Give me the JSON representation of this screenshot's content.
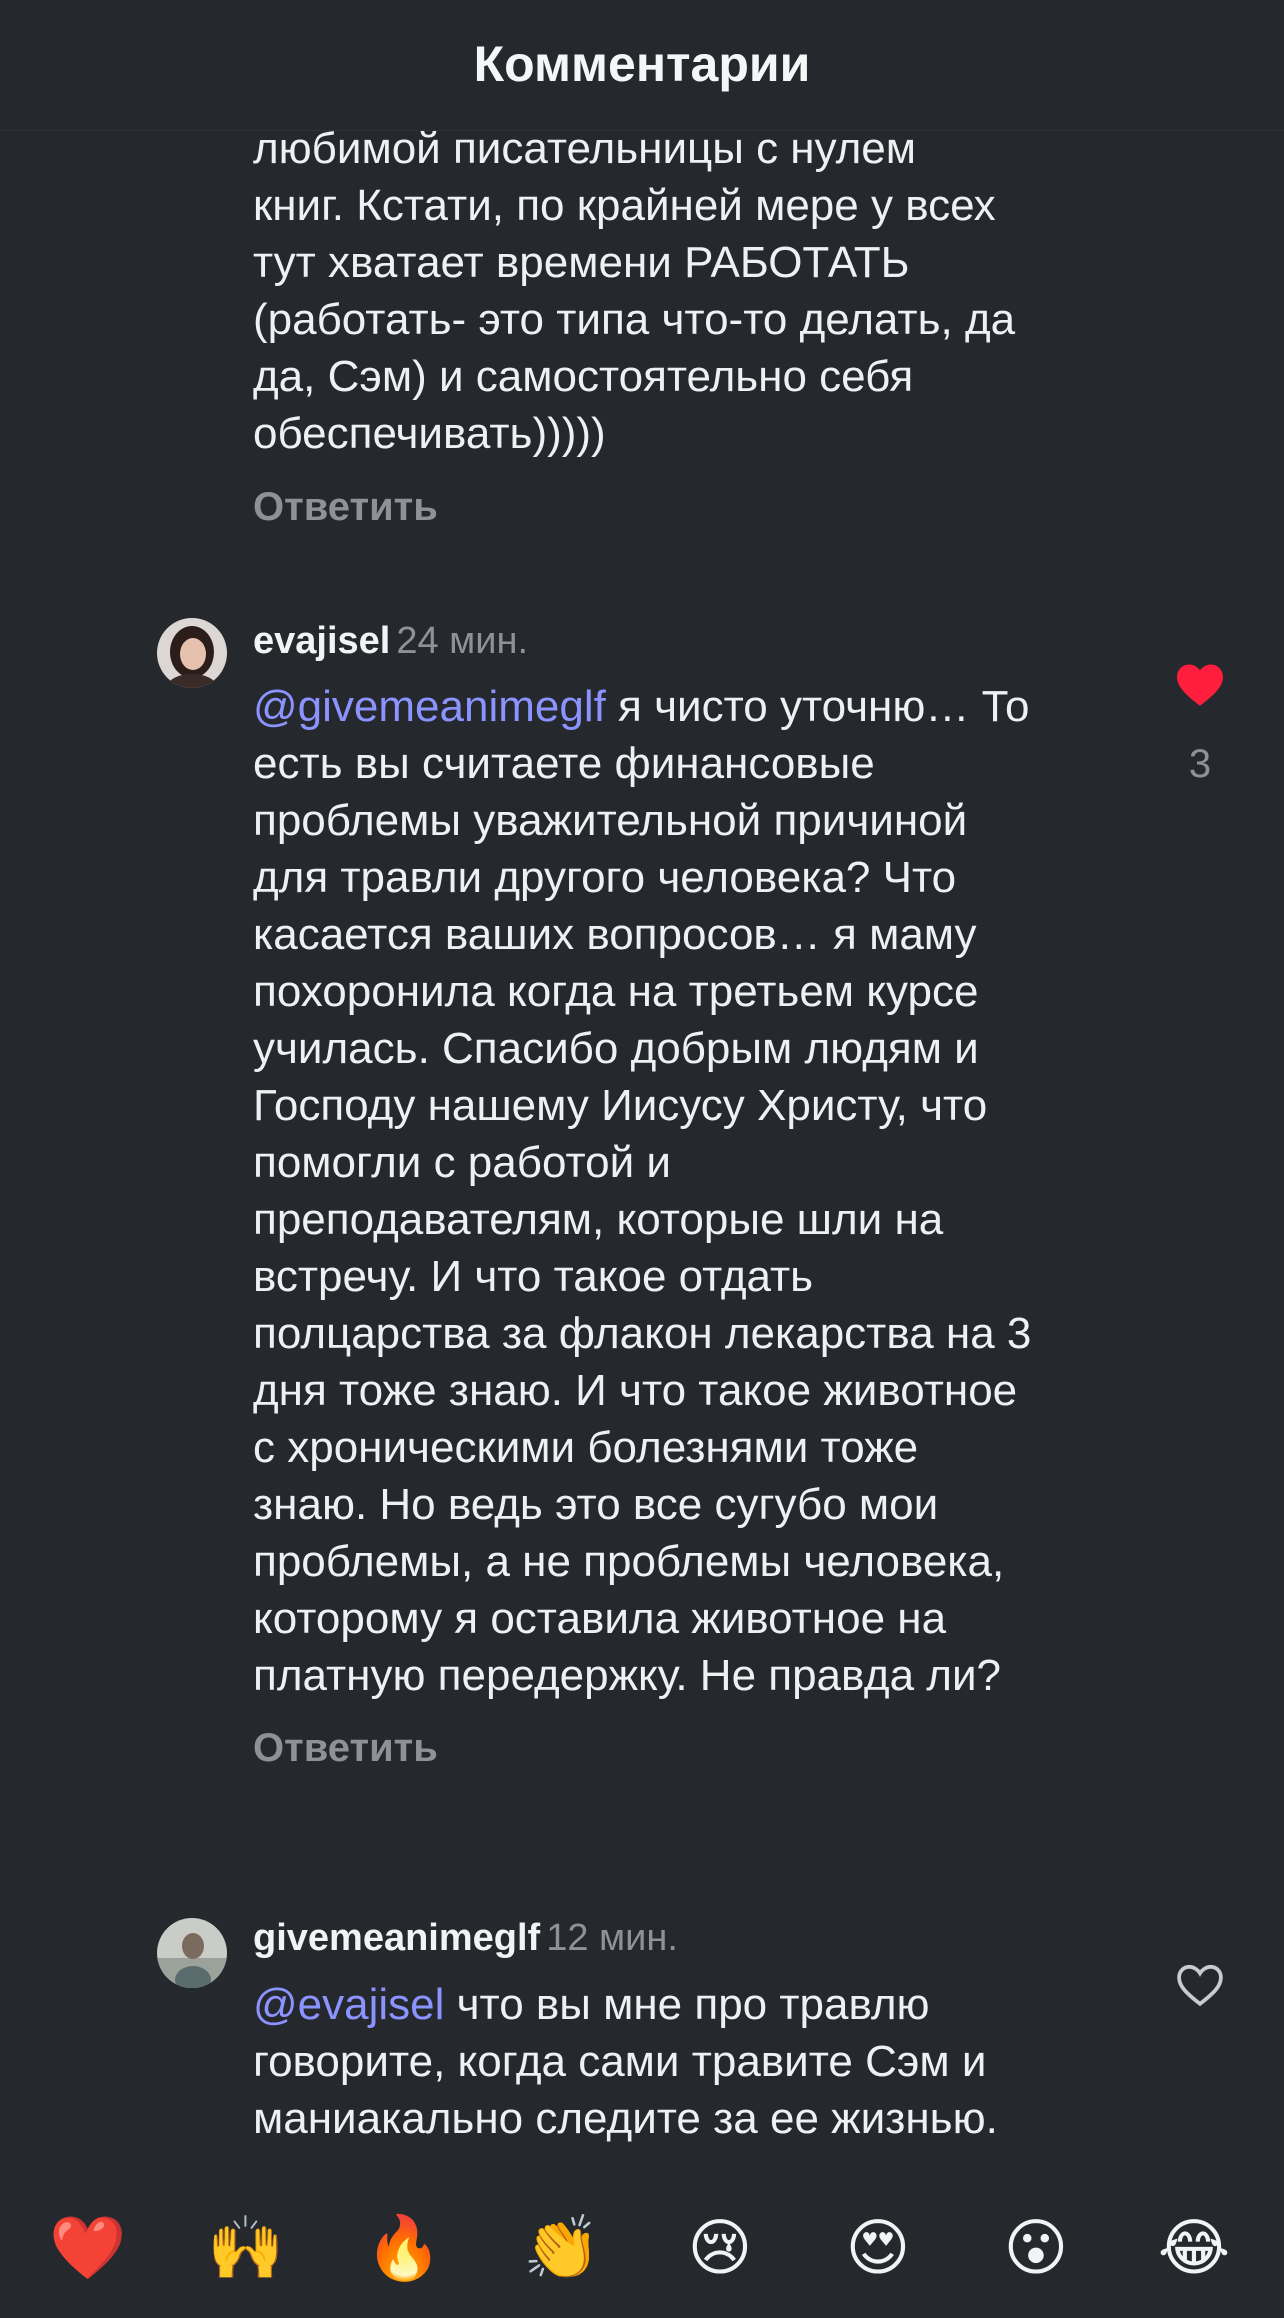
{
  "header": {
    "title": "Комментарии"
  },
  "comments": [
    {
      "text": "любимой писательницы с нулем\nкниг. Кстати, по крайней мере у всех\nтут хватает времени РАБОТАТЬ\n(работать- это типа что-то делать, да\nда, Сэм) и самостоятельно себя\nобеспечивать)))))",
      "reply": "Ответить"
    },
    {
      "username": "evajisel",
      "time": "24 мин.",
      "mention": "@givemeanimeglf",
      "text": " я чисто уточню… То\nесть вы считаете финансовые\nпроблемы уважительной причиной\nдля травли другого человека?  Что\nкасается ваших вопросов… я маму\nпохоронила когда на третьем курсе\nучилась. Спасибо добрым людям и\nГосподу нашему Иисусу Христу, что\nпомогли с работой и\nпреподавателям, которые шли на\nвстречу.  И что такое отдать\nполцарства за флакон лекарства на 3\nдня тоже знаю. И что такое животное\nс хроническими болезнями тоже\nзнаю. Но ведь это все сугубо мои\nпроблемы, а не проблемы человека,\nкоторому я оставила животное на\nплатную передержку. Не правда ли?",
      "reply": "Ответить",
      "likes": "3",
      "liked": true
    },
    {
      "username": "givemeanimeglf",
      "time": "12 мин.",
      "mention": "@evajisel",
      "text": " что вы мне про травлю\nговорите, когда сами травите Сэм и\nманиакально следите за ее жизнью.",
      "liked": false
    }
  ],
  "emoji_bar": [
    "❤️",
    "🙌",
    "🔥",
    "👏",
    "😢",
    "😍",
    "😮",
    "😂"
  ],
  "colors": {
    "background": "#25282c",
    "mention": "#8b93ff",
    "like_active": "#ff1f3d",
    "muted": "#8e9298"
  }
}
